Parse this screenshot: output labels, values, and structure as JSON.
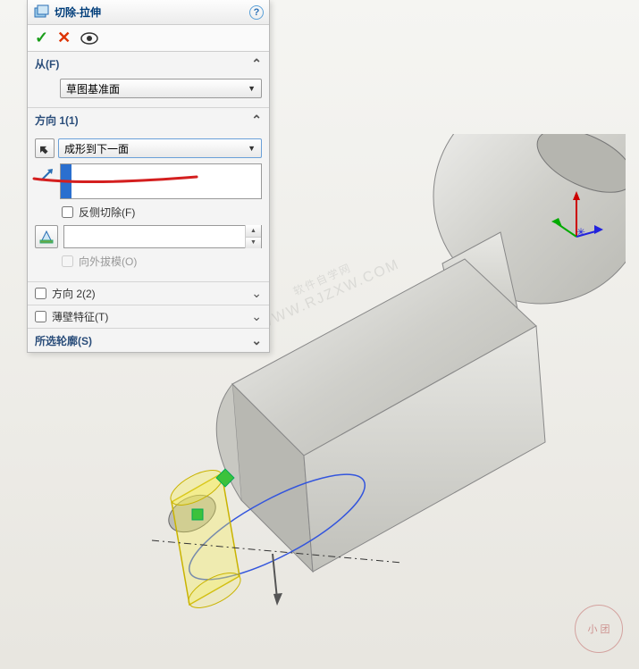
{
  "panel": {
    "title": "切除-拉伸",
    "help": "?"
  },
  "from": {
    "header": "从(F)",
    "plane": "草图基准面"
  },
  "dir1": {
    "header": "方向 1(1)",
    "endcond": "成形到下一面",
    "flip_side": "反侧切除(F)",
    "draft_out": "向外拔模(O)"
  },
  "dir2": {
    "label": "方向 2(2)"
  },
  "thin": {
    "label": "薄壁特征(T)"
  },
  "contours": {
    "label": "所选轮廓(S)"
  },
  "watermark": {
    "line1": "软件自学网",
    "line2": "WWW.RJZXW.COM"
  },
  "badge": "小 团"
}
